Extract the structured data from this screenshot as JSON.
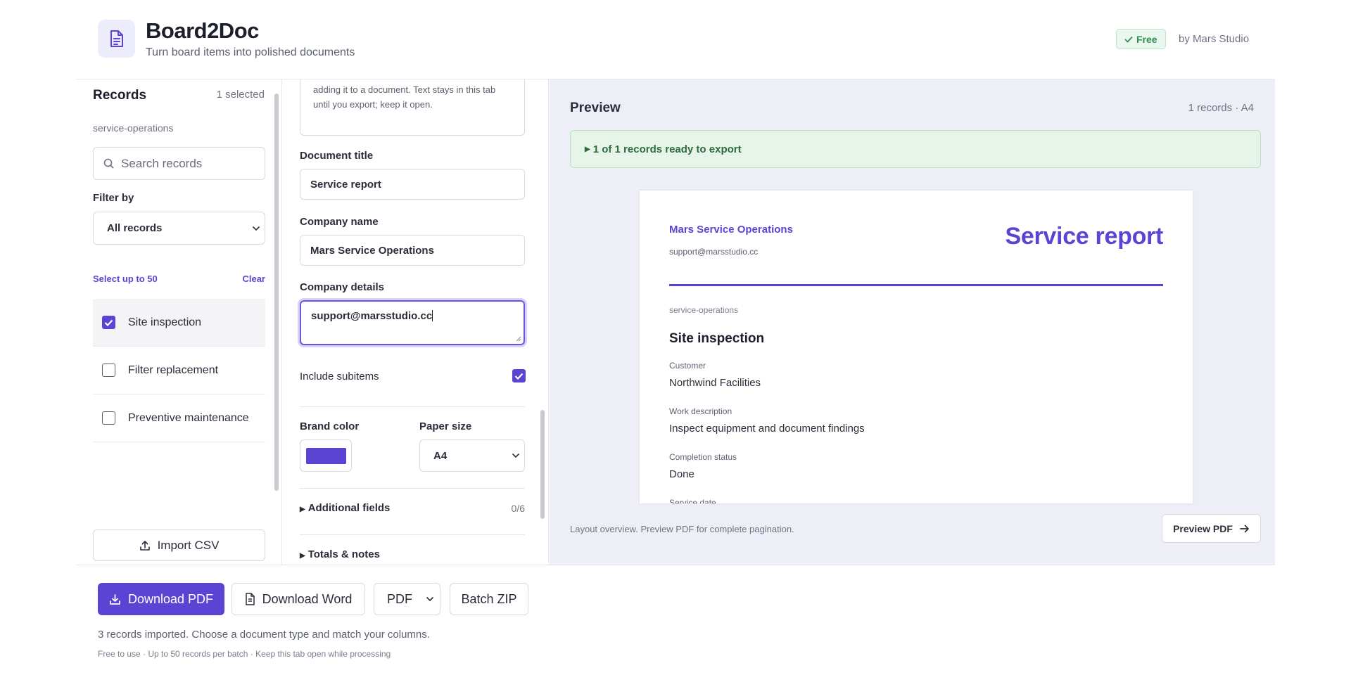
{
  "header": {
    "title": "Board2Doc",
    "subtitle": "Turn board items into polished documents",
    "badge": "Free",
    "byline": "by Mars Studio"
  },
  "records_panel": {
    "title": "Records",
    "selected_count": "1 selected",
    "source": "service-operations",
    "search_placeholder": "Search records",
    "filter_label": "Filter by",
    "filter_value": "All records",
    "select_hint": "Select up to 50",
    "clear_label": "Clear",
    "items": [
      {
        "label": "Site inspection",
        "checked": true
      },
      {
        "label": "Filter replacement",
        "checked": false
      },
      {
        "label": "Preventive maintenance",
        "checked": false
      }
    ],
    "import_label": "Import CSV"
  },
  "settings": {
    "intro_text": "adding it to a document. Text stays in this tab until you export; keep it open.",
    "doc_title_label": "Document title",
    "doc_title_value": "Service report",
    "company_name_label": "Company name",
    "company_name_value": "Mars Service Operations",
    "company_details_label": "Company details",
    "company_details_value": "support@marsstudio.cc",
    "include_subitems_label": "Include subitems",
    "include_subitems": true,
    "brand_color_label": "Brand color",
    "brand_color": "#5b44d4",
    "paper_size_label": "Paper size",
    "paper_size_value": "A4",
    "additional_fields_label": "Additional fields",
    "additional_fields_count": "0/6",
    "totals_label": "Totals & notes"
  },
  "preview": {
    "title": "Preview",
    "meta": "1 records · A4",
    "ready_text": "1 of 1 records ready to export",
    "doc": {
      "company": "Mars Service Operations",
      "email": "support@marsstudio.cc",
      "title": "Service report",
      "source": "service-operations",
      "heading": "Site inspection",
      "fields": [
        {
          "label": "Customer",
          "value": "Northwind Facilities"
        },
        {
          "label": "Work description",
          "value": "Inspect equipment and document findings"
        },
        {
          "label": "Completion status",
          "value": "Done"
        },
        {
          "label": "Service date",
          "value": ""
        }
      ]
    },
    "layout_note": "Layout overview. Preview PDF for complete pagination.",
    "preview_pdf_label": "Preview PDF"
  },
  "footer": {
    "download_pdf": "Download PDF",
    "download_word": "Download Word",
    "format_value": "PDF",
    "batch_zip": "Batch ZIP",
    "status": "3 records imported. Choose a document type and match your columns.",
    "fine_print": "Free to use · Up to 50 records per batch · Keep this tab open while processing"
  }
}
